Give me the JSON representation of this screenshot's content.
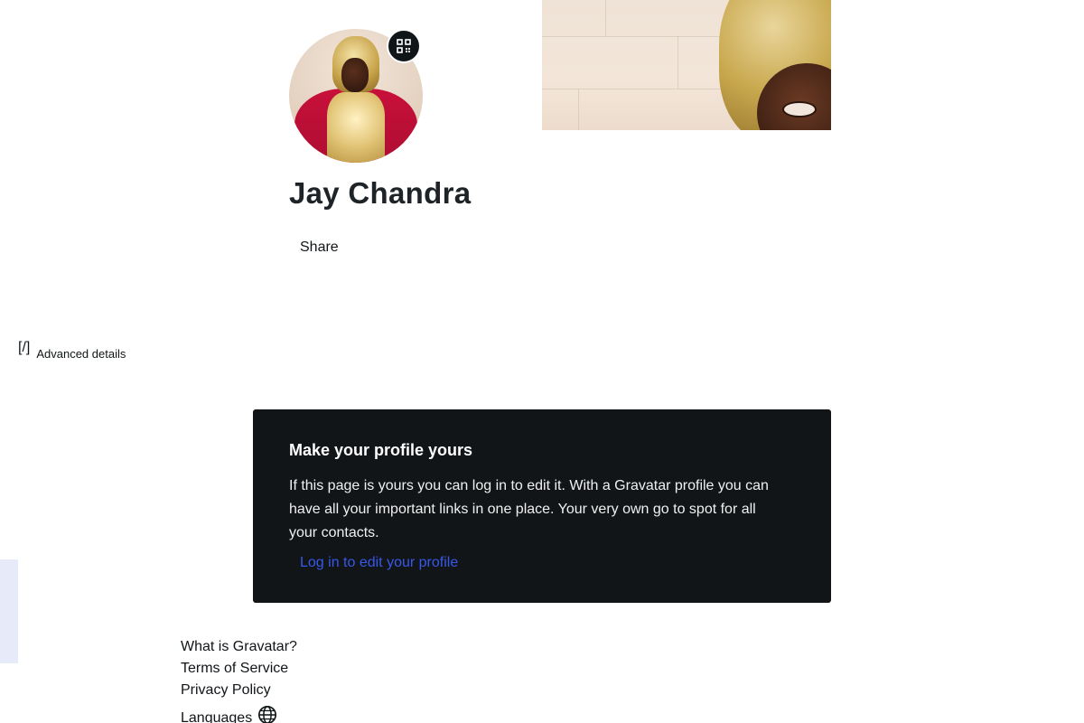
{
  "profile": {
    "name": "Jay Chandra",
    "share_label": "Share",
    "advanced_icon": "[/]",
    "advanced_label": "Advanced details"
  },
  "cta": {
    "title": "Make your profile yours",
    "body": "If this page is yours you can log in to edit it. With a Gravatar profile you can have all your important links in one place. Your very own go to spot for all your contacts.",
    "link_label": "Log in to edit your profile"
  },
  "footer": {
    "links": [
      "What is Gravatar?",
      "Terms of Service",
      "Privacy Policy"
    ],
    "languages_label": "Languages"
  },
  "icons": {
    "qr": "qr-code-icon",
    "globe": "globe-icon"
  },
  "colors": {
    "card_bg": "#111518",
    "link": "#3858e9",
    "text": "#101517"
  }
}
